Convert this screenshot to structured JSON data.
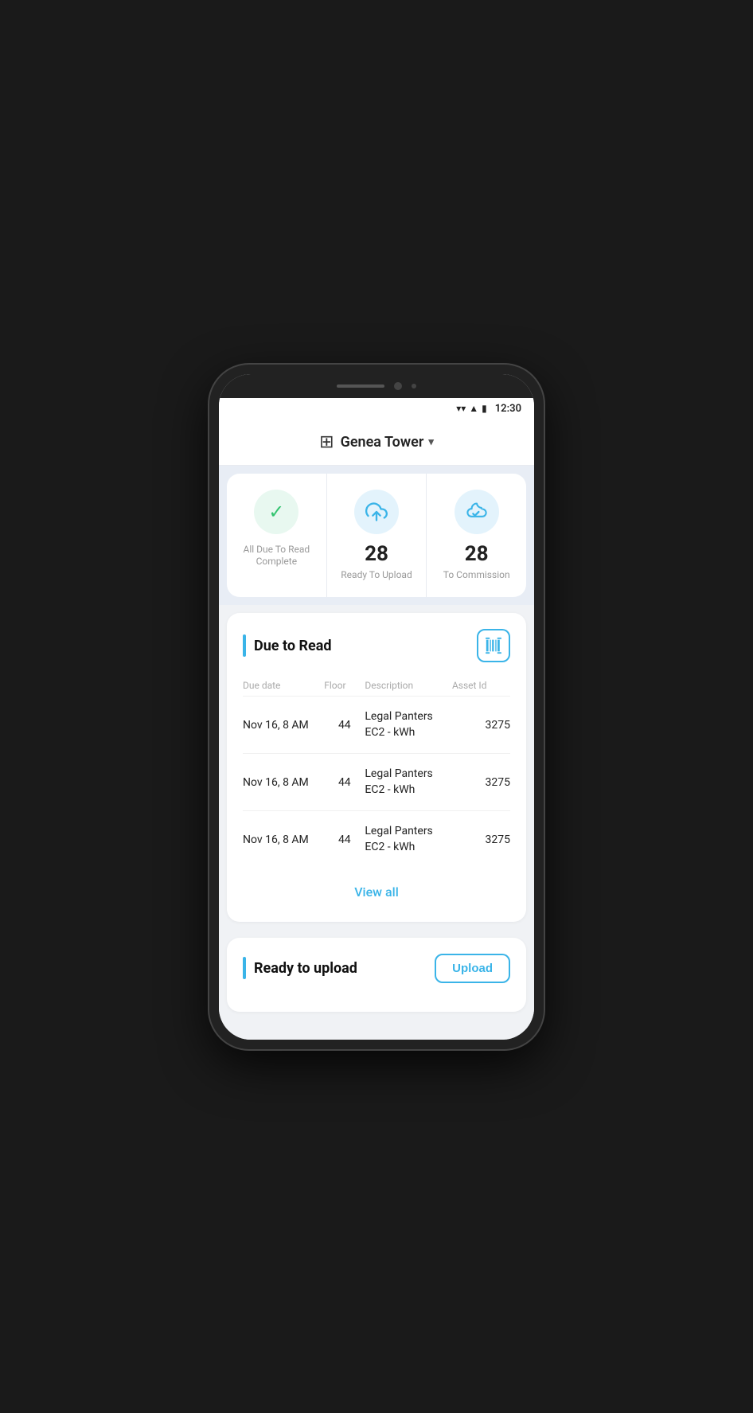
{
  "device": {
    "time": "12:30"
  },
  "header": {
    "building_icon": "🏢",
    "title": "Genea Tower",
    "chevron": "▾"
  },
  "summary": {
    "items": [
      {
        "id": "all-due-read",
        "icon_type": "check",
        "label": "All Due To Read Complete",
        "count": null
      },
      {
        "id": "ready-upload",
        "icon_type": "upload",
        "label": "Ready To Upload",
        "count": "28"
      },
      {
        "id": "to-commission",
        "icon_type": "commission",
        "label": "To Commission",
        "count": "28"
      }
    ]
  },
  "due_to_read": {
    "section_title": "Due to Read",
    "columns": [
      "Due date",
      "Floor",
      "Description",
      "Asset Id"
    ],
    "rows": [
      {
        "due_date": "Nov 16, 8 AM",
        "floor": "44",
        "description": "Legal Panters\nEC2 - kWh",
        "asset_id": "3275"
      },
      {
        "due_date": "Nov 16, 8 AM",
        "floor": "44",
        "description": "Legal Panters\nEC2 - kWh",
        "asset_id": "3275"
      },
      {
        "due_date": "Nov 16, 8 AM",
        "floor": "44",
        "description": "Legal Panters\nEC2 - kWh",
        "asset_id": "3275"
      }
    ],
    "view_all_label": "View all"
  },
  "ready_to_upload": {
    "section_title": "Ready to upload",
    "upload_button_label": "Upload"
  }
}
